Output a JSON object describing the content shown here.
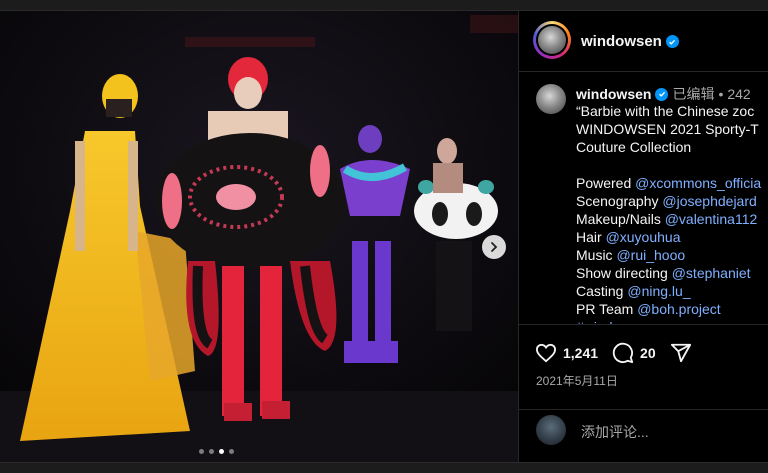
{
  "post": {
    "username": "windowsen",
    "edited_label": "已编辑",
    "time_label": "242",
    "caption_lines": [
      [
        {
          "t": "“Barbie with the Chinese zoc",
          "link": false
        }
      ],
      [
        {
          "t": "WINDOWSEN 2021 Sporty-T",
          "link": false
        }
      ],
      [
        {
          "t": "Couture Collection",
          "link": false
        }
      ],
      [],
      [
        {
          "t": "Powered ",
          "link": false
        },
        {
          "t": "@xcommons_officia",
          "link": true
        }
      ],
      [
        {
          "t": "Scenography ",
          "link": false
        },
        {
          "t": "@josephdejard",
          "link": true
        }
      ],
      [
        {
          "t": "Makeup/Nails ",
          "link": false
        },
        {
          "t": "@valentina112",
          "link": true
        }
      ],
      [
        {
          "t": "Hair ",
          "link": false
        },
        {
          "t": "@xuyouhua",
          "link": true
        }
      ],
      [
        {
          "t": "Music ",
          "link": false
        },
        {
          "t": "@rui_hooo",
          "link": true
        }
      ],
      [
        {
          "t": "Show directing ",
          "link": false
        },
        {
          "t": "@stephaniet",
          "link": true
        }
      ],
      [
        {
          "t": "Casting ",
          "link": false
        },
        {
          "t": "@ning.lu_",
          "link": true
        }
      ],
      [
        {
          "t": "PR Team ",
          "link": false
        },
        {
          "t": "@boh.project",
          "link": true
        }
      ],
      [
        {
          "t": "#windowsen",
          "link": true
        }
      ]
    ],
    "likes": "1,241",
    "comments_count": "20",
    "date": "2021年5月11日",
    "comment_placeholder": "添加评论...",
    "carousel": {
      "count": 4,
      "active_index": 2
    }
  },
  "icons": {
    "verified": "verified-badge-icon",
    "like": "heart-icon",
    "comment": "speech-bubble-icon",
    "share": "paper-plane-icon",
    "next": "chevron-right-icon"
  },
  "colors": {
    "background": "#000000",
    "link": "#7fb0ff",
    "verified": "#0095f6",
    "muted": "#a8a8a8"
  }
}
